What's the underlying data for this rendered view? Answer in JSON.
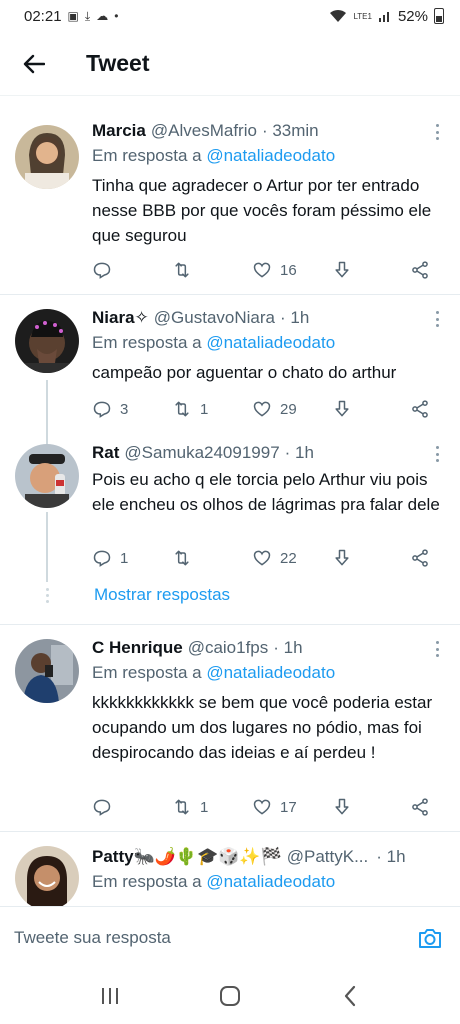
{
  "status_bar": {
    "time": "02:21",
    "battery": "52%",
    "network": "LTE1"
  },
  "appbar": {
    "title": "Tweet"
  },
  "tweets": [
    {
      "name": "Marcia",
      "handle": "@AlvesMafrio",
      "time": "· 33min",
      "reply_label": "Em resposta a",
      "reply_to": "@nataliadeodato",
      "text": "Tinha que agradecer o Artur por ter entrado nesse BBB por que vocês foram péssimo ele que segurou",
      "replies": "",
      "retweets": "",
      "likes": "16"
    },
    {
      "name": "Niara✧",
      "handle": "@GustavoNiara",
      "time": "· 1h",
      "reply_label": "Em resposta a",
      "reply_to": "@nataliadeodato",
      "text": "campeão por aguentar o chato do arthur",
      "replies": "3",
      "retweets": "1",
      "likes": "29"
    },
    {
      "name": "Rat",
      "handle": "@Samuka24091997",
      "time": "· 1h",
      "reply_label": "",
      "reply_to": "",
      "text": "Pois eu acho q ele torcia pelo Arthur viu pois ele encheu os olhos de lágrimas pra falar dele",
      "replies": "1",
      "retweets": "",
      "likes": "22"
    },
    {
      "name": "C Henrique",
      "handle": "@caio1fps",
      "time": "· 1h",
      "reply_label": "Em resposta a",
      "reply_to": "@nataliadeodato",
      "text": "kkkkkkkkkkkk se bem que você poderia estar ocupando um dos lugares no pódio, mas foi despirocando das ideias e aí perdeu !",
      "replies": "",
      "retweets": "1",
      "likes": "17"
    },
    {
      "name": "Patty🐜🌶️🌵🎓🎲✨🏁",
      "handle": "@PattyK...",
      "time": "· 1h",
      "reply_label": "Em resposta a",
      "reply_to": "@nataliadeodato",
      "text": ""
    }
  ],
  "show_replies": "Mostrar respostas",
  "composer": {
    "placeholder": "Tweete sua resposta"
  },
  "colors": {
    "accent": "#1d9bf0",
    "secondary_text": "#536471",
    "divider": "#e6ecf0"
  },
  "icons": [
    "back-arrow-icon",
    "more-icon",
    "reply-icon",
    "retweet-icon",
    "like-icon",
    "share-icon",
    "camera-icon",
    "recents-icon",
    "home-icon",
    "back-icon"
  ]
}
